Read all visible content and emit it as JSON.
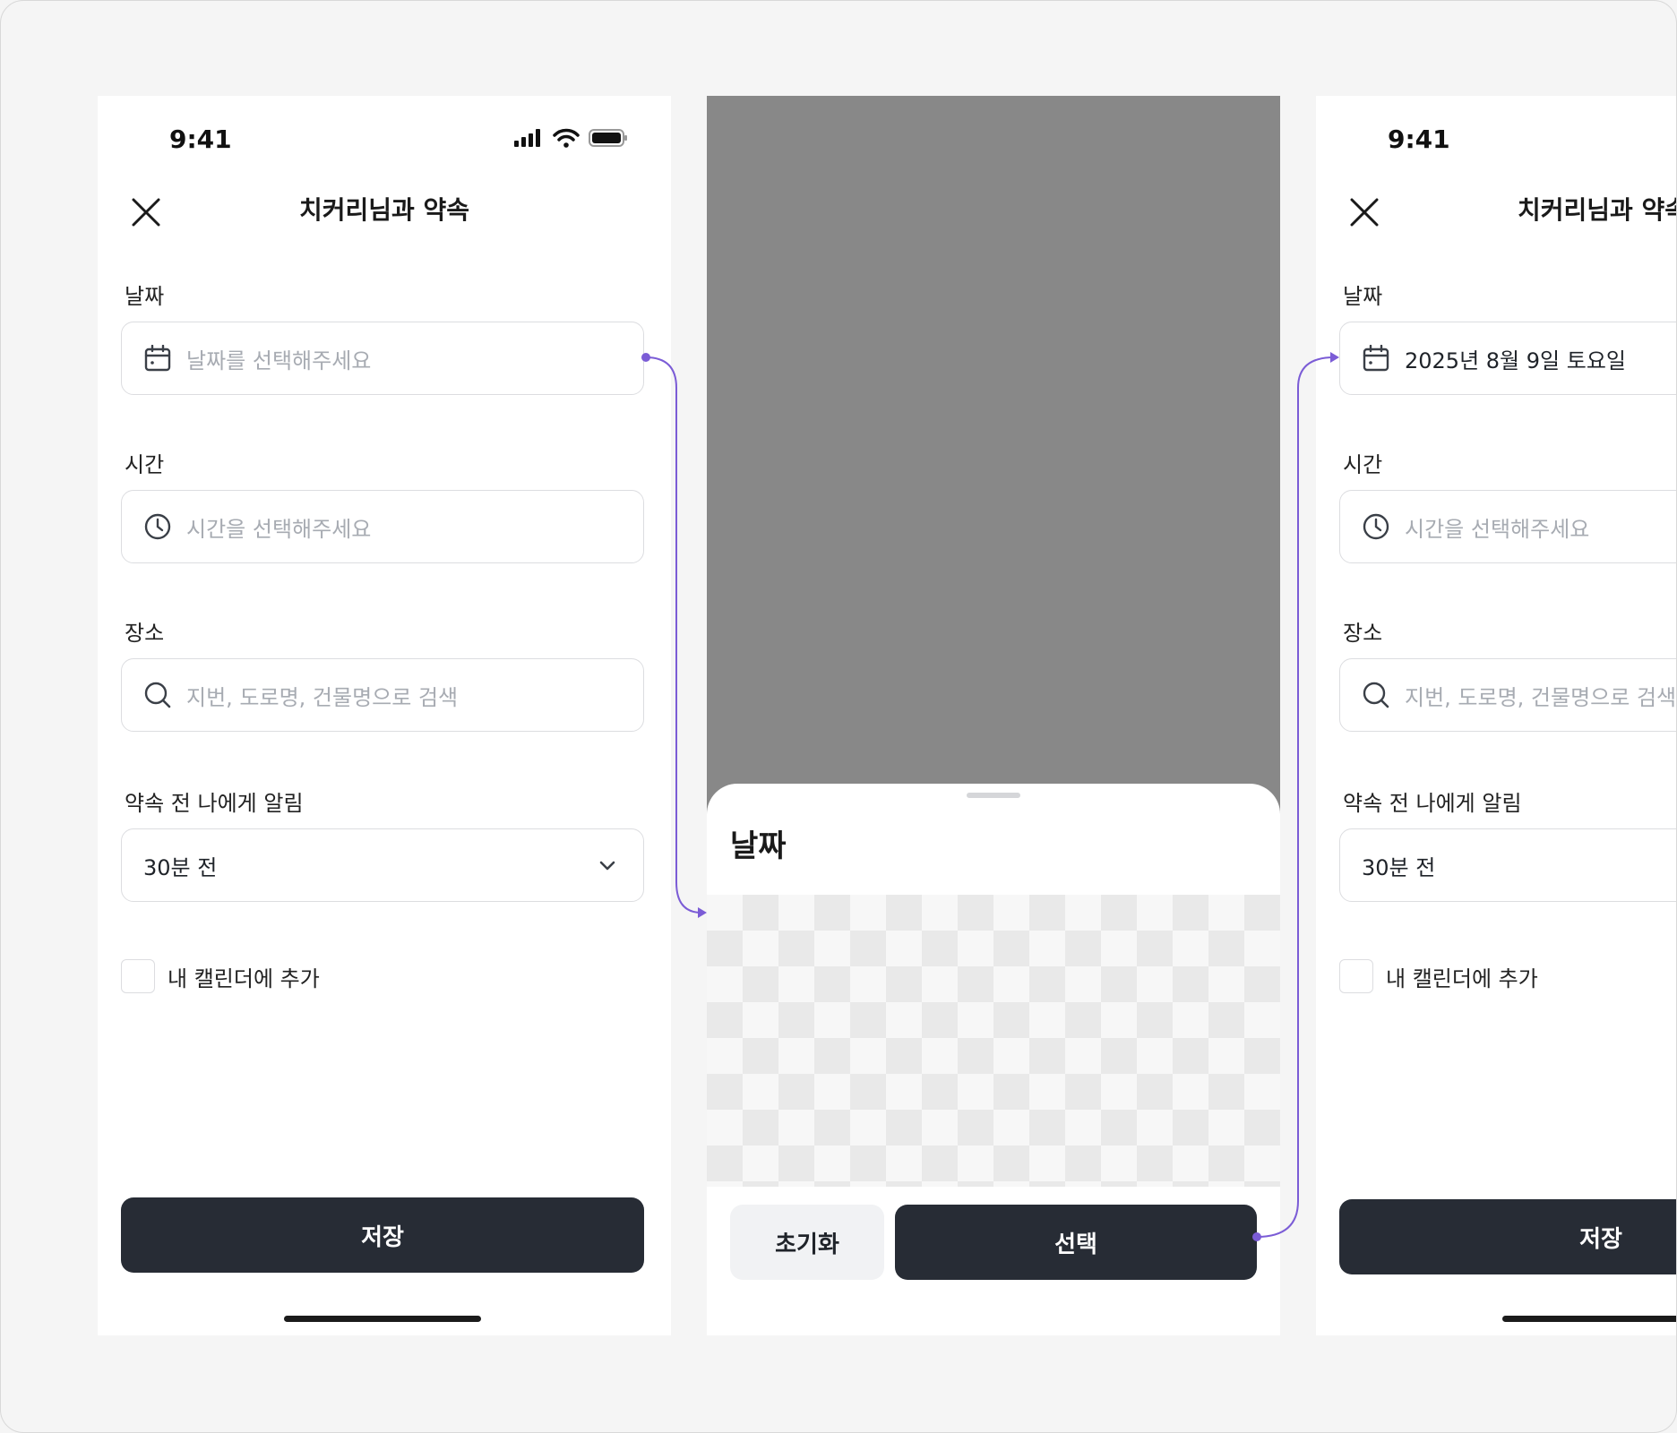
{
  "screens": {
    "form_empty": {
      "status_time": "9:41",
      "title": "치커리님과 약속",
      "date_label": "날짜",
      "date_placeholder": "날짜를 선택해주세요",
      "time_label": "시간",
      "time_placeholder": "시간을 선택해주세요",
      "place_label": "장소",
      "place_placeholder": "지번, 도로명, 건물명으로 검색",
      "alarm_label": "약속 전 나에게 알림",
      "alarm_value": "30분 전",
      "calendar_label": "내 캘린더에 추가",
      "save_label": "저장"
    },
    "date_sheet": {
      "title": "날짜",
      "reset_label": "초기화",
      "select_label": "선택"
    },
    "form_filled": {
      "status_time": "9:41",
      "title": "치커리님과 약속",
      "date_label": "날짜",
      "date_value": "2025년 8월 9일 토요일",
      "time_label": "시간",
      "time_placeholder": "시간을 선택해주세요",
      "place_label": "장소",
      "place_placeholder": "지번, 도로명, 건물명으로 검색",
      "alarm_label": "약속 전 나에게 알림",
      "alarm_value": "30분 전",
      "calendar_label": "내 캘린더에 추가",
      "save_label": "저장"
    }
  },
  "icons": {
    "close": "close-icon",
    "calendar": "calendar-icon",
    "clock": "clock-icon",
    "search": "search-icon",
    "chevron": "chevron-down-icon"
  },
  "colors": {
    "primary_button": "#272c35",
    "secondary_button": "#f1f2f4",
    "connector": "#7b5cd6",
    "placeholder": "#a7abb2",
    "border": "#dcdde0",
    "overlay": "#888888"
  }
}
